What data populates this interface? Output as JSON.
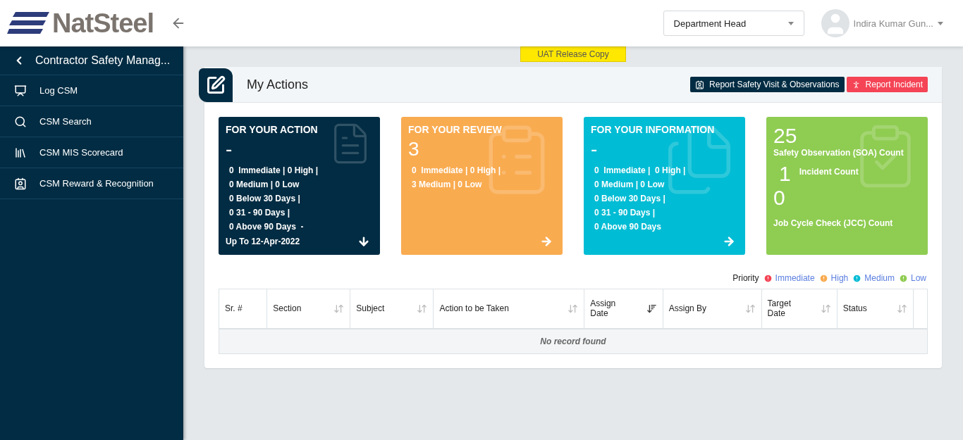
{
  "header": {
    "logo_text": "NatSteel",
    "role_select": {
      "value": "Department Head"
    },
    "user_name": "Indira Kumar Gun..."
  },
  "sidebar": {
    "title": "Contractor Safety Manag...",
    "items": [
      {
        "label": "Log CSM"
      },
      {
        "label": "CSM Search"
      },
      {
        "label": "CSM MIS Scorecard"
      },
      {
        "label": "CSM Reward & Recognition"
      }
    ]
  },
  "banner": "UAT Release Copy",
  "panel": {
    "title": "My Actions",
    "buttons": [
      {
        "label": "Report Safety Visit & Observations",
        "kind": "dark"
      },
      {
        "label": "Report Incident",
        "kind": "danger"
      }
    ]
  },
  "cards": [
    {
      "kind": "list",
      "color": "#022c43",
      "title": "FOR YOUR ACTION",
      "count": "-",
      "lines": [
        "0  Immediate | 0 High |",
        "0 Medium | 0 Low",
        "0 Below 30 Days |",
        "0 31 - 90 Days |",
        "0 Above 90 Days  -"
      ],
      "footer": "Up To 12-Apr-2022"
    },
    {
      "kind": "list",
      "color": "#f9ab50",
      "title": "FOR YOUR REVIEW",
      "count": "3",
      "lines": [
        "0  Immediate | 0 High |",
        "3 Medium | 0 Low"
      ]
    },
    {
      "kind": "list",
      "color": "#00bcd4",
      "title": "FOR YOUR INFORMATION",
      "count": "-",
      "lines": [
        "0  Immediate |  0 High |",
        "0 Medium | 0 Low",
        "0 Below 30 Days |",
        "0 31 - 90 Days |",
        "0 Above 90 Days"
      ]
    },
    {
      "kind": "summary",
      "color": "#8fcc52",
      "stats": [
        {
          "value": "25",
          "label": "Safety Observation (SOA) Count"
        },
        {
          "value": "1",
          "label": "Incident Count"
        },
        {
          "value": "0",
          "label": "Job Cycle Check (JCC) Count"
        }
      ]
    }
  ],
  "legend": {
    "label": "Priority",
    "items": [
      {
        "label": "Immediate",
        "color": "#f44455"
      },
      {
        "label": "High",
        "color": "#f9ab50"
      },
      {
        "label": "Medium",
        "color": "#00bcd4"
      },
      {
        "label": "Low",
        "color": "#8fcc52"
      }
    ]
  },
  "table": {
    "columns": [
      {
        "label": "Sr. #"
      },
      {
        "label": "Section"
      },
      {
        "label": "Subject"
      },
      {
        "label": "Action to be Taken"
      },
      {
        "label": "Assign Date"
      },
      {
        "label": "Assign By"
      },
      {
        "label": "Target Date"
      },
      {
        "label": "Status"
      }
    ],
    "empty_message": "No record found"
  }
}
